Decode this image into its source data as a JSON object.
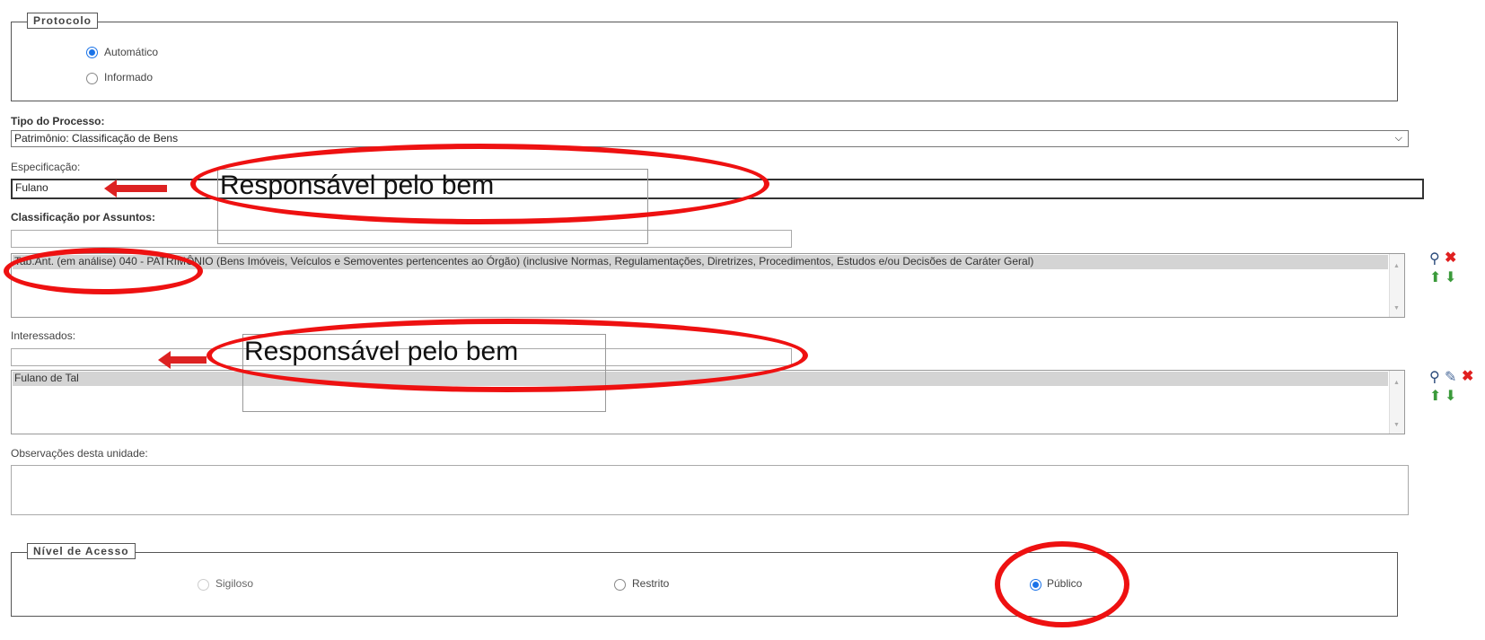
{
  "protocolo": {
    "legend": "Protocolo",
    "options": [
      {
        "label": "Automático",
        "selected": true
      },
      {
        "label": "Informado",
        "selected": false
      }
    ]
  },
  "tipo_processo": {
    "label": "Tipo do Processo:",
    "value": "Patrimônio: Classificação de Bens"
  },
  "especificacao": {
    "label": "Especificação:",
    "value": "Fulano"
  },
  "classificacao": {
    "label": "Classificação por Assuntos:",
    "selected_item": "Tab.Ant. (em análise) 040 - PATRIMÔNIO (Bens Imóveis, Veículos e Semoventes pertencentes ao Órgão) (inclusive Normas, Regulamentações, Diretrizes, Procedimentos, Estudos e/ou Decisões de Caráter Geral)"
  },
  "interessados": {
    "label": "Interessados:",
    "selected_item": "Fulano de Tal"
  },
  "observacoes": {
    "label": "Observações desta unidade:"
  },
  "nivel_acesso": {
    "legend": "Nível de Acesso",
    "options": [
      {
        "label": "Sigiloso",
        "selected": false,
        "disabled": true
      },
      {
        "label": "Restrito",
        "selected": false
      },
      {
        "label": "Público",
        "selected": true
      }
    ]
  },
  "annotations": {
    "callout_1": "Responsável pelo bem",
    "callout_2": "Responsável pelo bem"
  },
  "colors": {
    "annotation_red": "#e11111",
    "radio_blue": "#1a73e8"
  },
  "icons": [
    "search-icon",
    "remove-icon",
    "move-up-icon",
    "move-down-icon",
    "edit-icon"
  ]
}
